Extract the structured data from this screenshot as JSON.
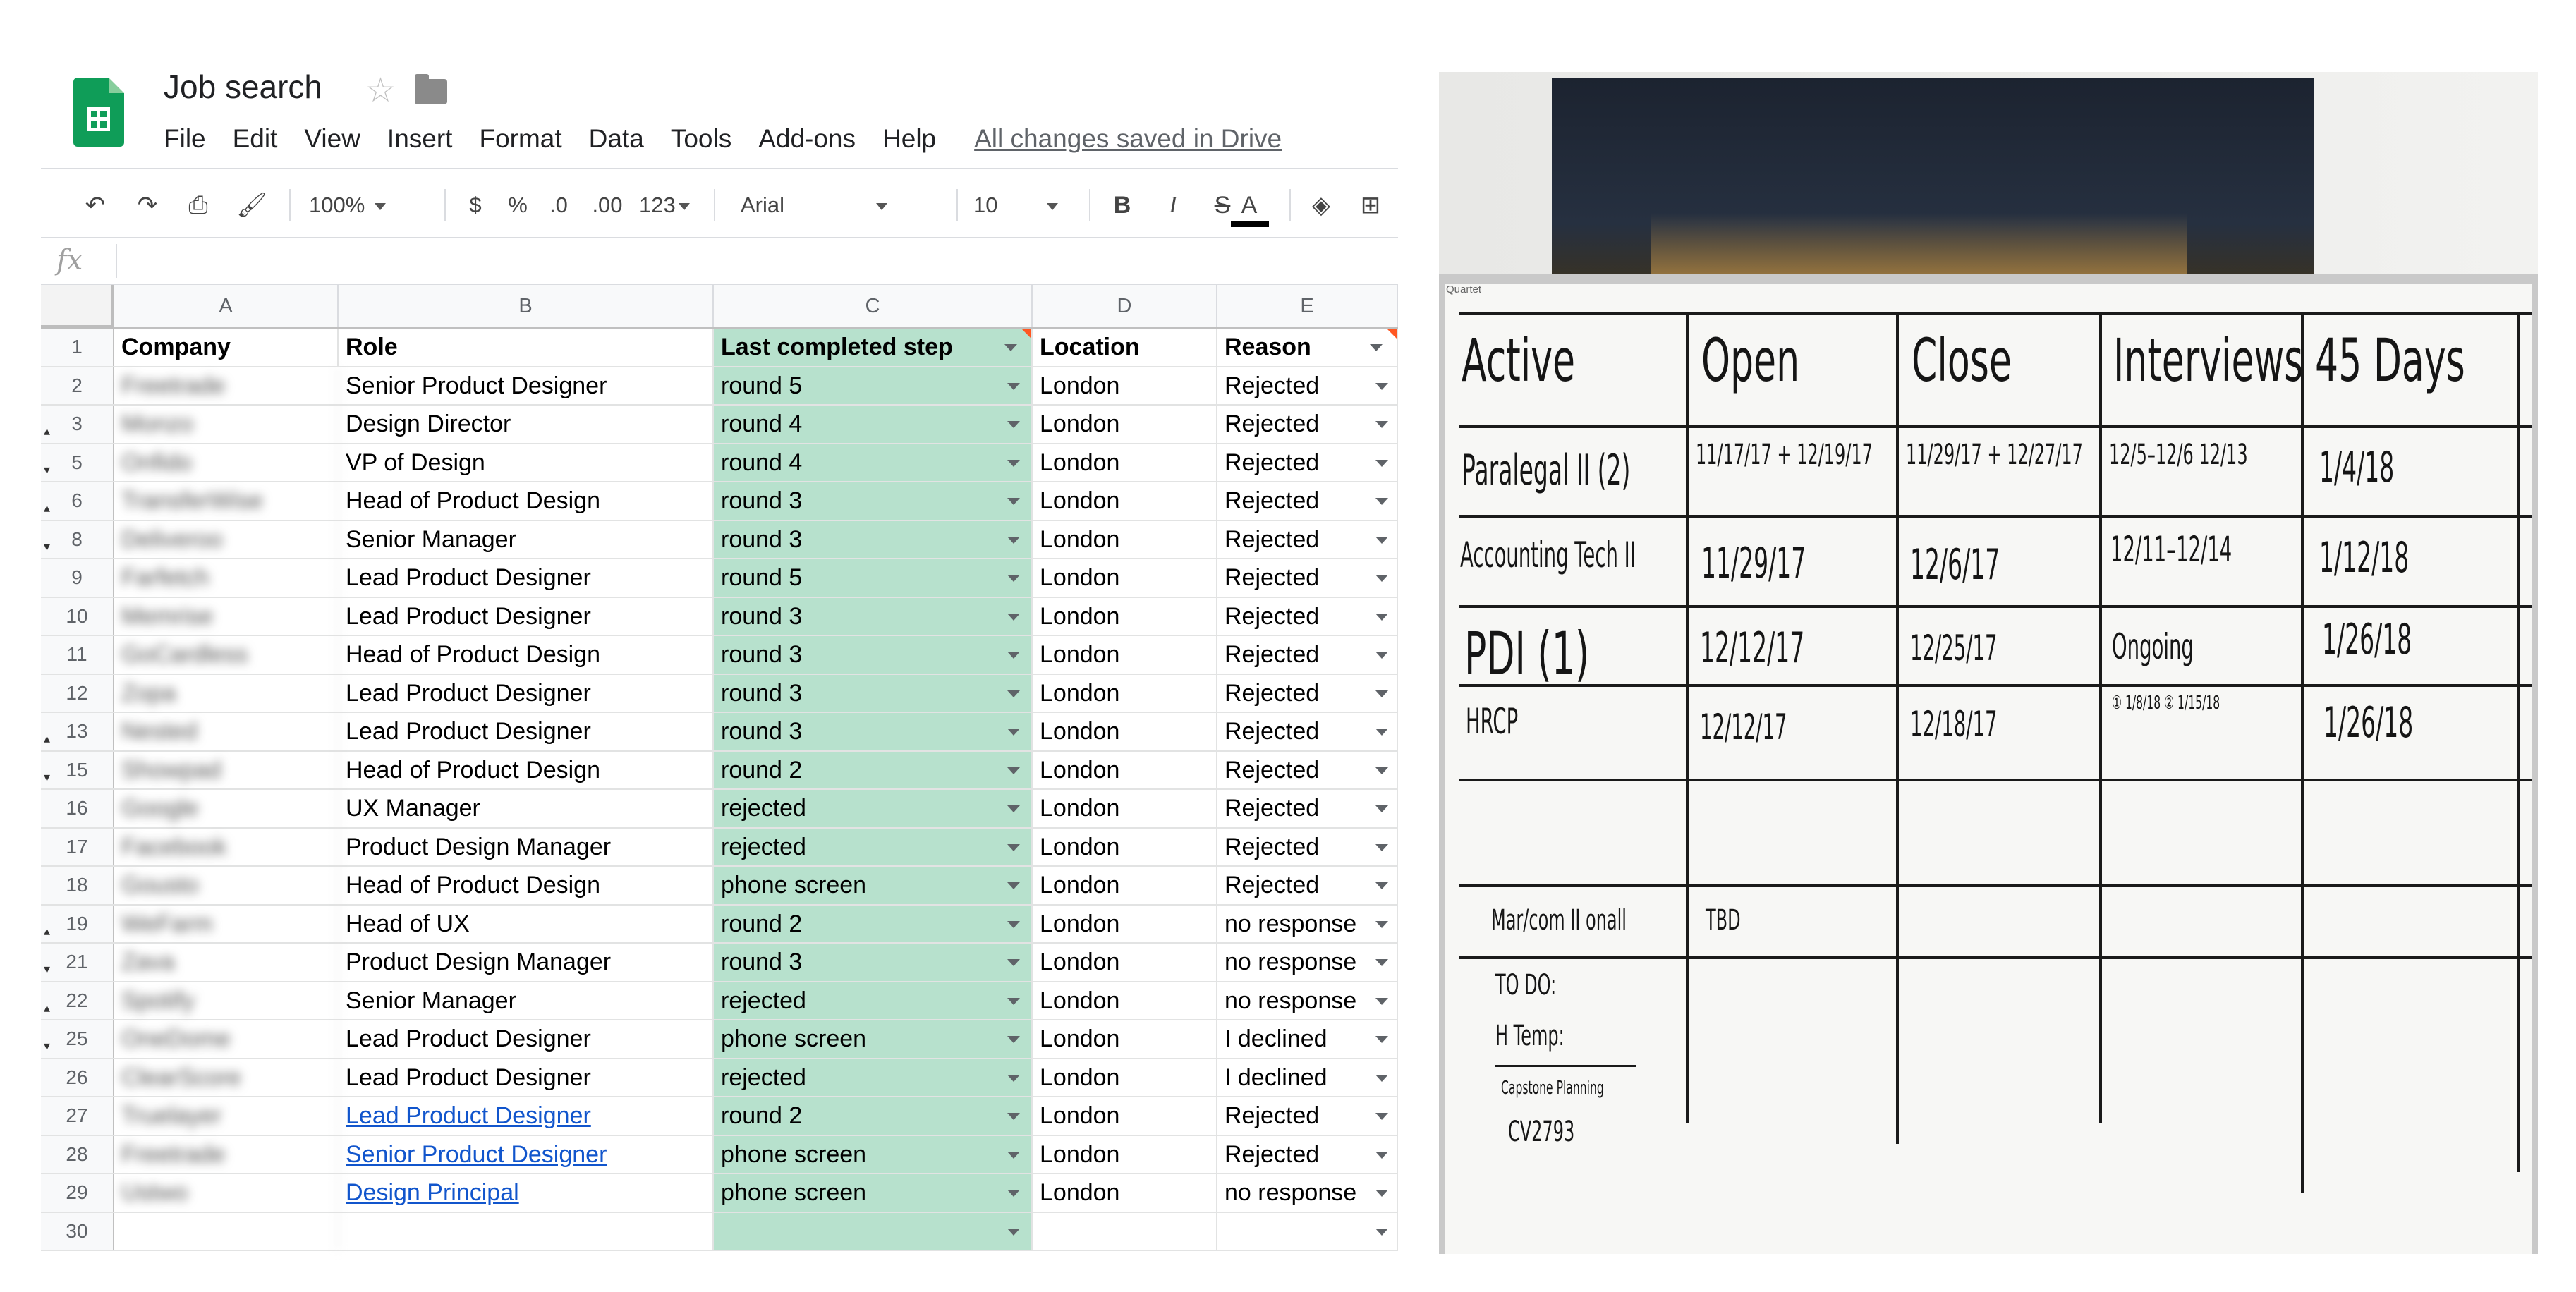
{
  "app": {
    "title": "Job search",
    "menu": [
      "File",
      "Edit",
      "View",
      "Insert",
      "Format",
      "Data",
      "Tools",
      "Add-ons",
      "Help"
    ],
    "save_status": "All changes saved in Drive"
  },
  "toolbar": {
    "zoom": "100%",
    "currency": "$",
    "percent": "%",
    "dec_decrease": ".0",
    "dec_increase": ".00",
    "more_formats": "123",
    "font": "Arial",
    "font_size": "10",
    "bold": "B",
    "italic": "I",
    "strike": "S",
    "text_color": "A"
  },
  "formula_bar": {
    "label": "fx",
    "value": ""
  },
  "sheet": {
    "columns": [
      "A",
      "B",
      "C",
      "D",
      "E"
    ],
    "header": {
      "num": "1",
      "company": "Company",
      "role": "Role",
      "step": "Last completed step",
      "location": "Location",
      "reason": "Reason"
    },
    "rows": [
      {
        "num": "2",
        "marker": "",
        "company": "Freetrade",
        "role": "Senior Product Designer",
        "step": "round 5",
        "location": "London",
        "reason": "Rejected",
        "link": false
      },
      {
        "num": "3",
        "marker": "▴",
        "company": "Monzo",
        "role": "Design Director",
        "step": "round 4",
        "location": "London",
        "reason": "Rejected",
        "link": false
      },
      {
        "num": "5",
        "marker": "▾",
        "company": "Onfido",
        "role": "VP of Design",
        "step": "round 4",
        "location": "London",
        "reason": "Rejected",
        "link": false
      },
      {
        "num": "6",
        "marker": "▴",
        "company": "TransferWise",
        "role": "Head of Product Design",
        "step": "round 3",
        "location": "London",
        "reason": "Rejected",
        "link": false
      },
      {
        "num": "8",
        "marker": "▾",
        "company": "Deliveroo",
        "role": "Senior Manager",
        "step": "round 3",
        "location": "London",
        "reason": "Rejected",
        "link": false
      },
      {
        "num": "9",
        "marker": "",
        "company": "Farfetch",
        "role": "Lead Product Designer",
        "step": "round 5",
        "location": "London",
        "reason": "Rejected",
        "link": false
      },
      {
        "num": "10",
        "marker": "",
        "company": "Memrise",
        "role": "Lead Product Designer",
        "step": "round 3",
        "location": "London",
        "reason": "Rejected",
        "link": false
      },
      {
        "num": "11",
        "marker": "",
        "company": "GoCardless",
        "role": "Head of Product Design",
        "step": "round 3",
        "location": "London",
        "reason": "Rejected",
        "link": false
      },
      {
        "num": "12",
        "marker": "",
        "company": "Zopa",
        "role": "Lead Product Designer",
        "step": "round 3",
        "location": "London",
        "reason": "Rejected",
        "link": false
      },
      {
        "num": "13",
        "marker": "▴",
        "company": "Nested",
        "role": "Lead Product Designer",
        "step": "round 3",
        "location": "London",
        "reason": "Rejected",
        "link": false
      },
      {
        "num": "15",
        "marker": "▾",
        "company": "Showpad",
        "role": "Head of Product Design",
        "step": "round 2",
        "location": "London",
        "reason": "Rejected",
        "link": false
      },
      {
        "num": "16",
        "marker": "",
        "company": "Google",
        "role": "UX Manager",
        "step": "rejected",
        "location": "London",
        "reason": "Rejected",
        "link": false
      },
      {
        "num": "17",
        "marker": "",
        "company": "Facebook",
        "role": "Product Design Manager",
        "step": "rejected",
        "location": "London",
        "reason": "Rejected",
        "link": false
      },
      {
        "num": "18",
        "marker": "",
        "company": "Gousto",
        "role": "Head of Product Design",
        "step": "phone screen",
        "location": "London",
        "reason": "Rejected",
        "link": false
      },
      {
        "num": "19",
        "marker": "▴",
        "company": "WeFarm",
        "role": "Head of UX",
        "step": "round 2",
        "location": "London",
        "reason": "no response",
        "link": false
      },
      {
        "num": "21",
        "marker": "▾",
        "company": "Zava",
        "role": "Product Design Manager",
        "step": "round 3",
        "location": "London",
        "reason": "no response",
        "link": false
      },
      {
        "num": "22",
        "marker": "▴",
        "company": "Spotify",
        "role": "Senior Manager",
        "step": "rejected",
        "location": "London",
        "reason": "no response",
        "link": false
      },
      {
        "num": "25",
        "marker": "▾",
        "company": "OneDome",
        "role": "Lead Product Designer",
        "step": "phone screen",
        "location": "London",
        "reason": "I declined",
        "link": false
      },
      {
        "num": "26",
        "marker": "",
        "company": "ClearScore",
        "role": "Lead Product Designer",
        "step": "rejected",
        "location": "London",
        "reason": "I declined",
        "link": false
      },
      {
        "num": "27",
        "marker": "",
        "company": "Truelayer",
        "role": "Lead Product Designer",
        "step": "round 2",
        "location": "London",
        "reason": "Rejected",
        "link": true
      },
      {
        "num": "28",
        "marker": "",
        "company": "Freetrade",
        "role": "Senior Product Designer",
        "step": "phone screen",
        "location": "London",
        "reason": "Rejected",
        "link": true
      },
      {
        "num": "29",
        "marker": "",
        "company": "Ustwo",
        "role": "Design Principal",
        "step": "phone screen",
        "location": "London",
        "reason": "no response",
        "link": true
      },
      {
        "num": "30",
        "marker": "",
        "company": "",
        "role": "",
        "step": "",
        "location": "",
        "reason": "",
        "link": false
      }
    ]
  },
  "whiteboard": {
    "brand": "Quartet",
    "headers": [
      "Active",
      "Open",
      "Close",
      "Interviews",
      "45 Days"
    ],
    "rows": [
      {
        "role": "Paralegal II (2)",
        "open": "11/17/17 + 12/19/17",
        "close": "11/29/17 + 12/27/17",
        "interviews": "12/5–12/6 12/13",
        "days45": "1/4/18"
      },
      {
        "role": "Accounting Tech II",
        "open": "11/29/17",
        "close": "12/6/17",
        "interviews": "12/11–12/14",
        "days45": "1/12/18"
      },
      {
        "role": "PDI (1)",
        "open": "12/12/17",
        "close": "12/25/17",
        "interviews": "Ongoing",
        "days45": "1/26/18"
      },
      {
        "role": "HRCP",
        "open": "12/12/17",
        "close": "12/18/17",
        "interviews": "① 1/8/18 ② 1/15/18",
        "days45": "1/26/18"
      }
    ],
    "notes": {
      "marcom": "Mar/com II onall",
      "marcom_open": "TBD",
      "todo": "TO DO:",
      "htemp": "H Temp:",
      "capstone": "Capstone Planning",
      "code": "CV2793"
    }
  }
}
